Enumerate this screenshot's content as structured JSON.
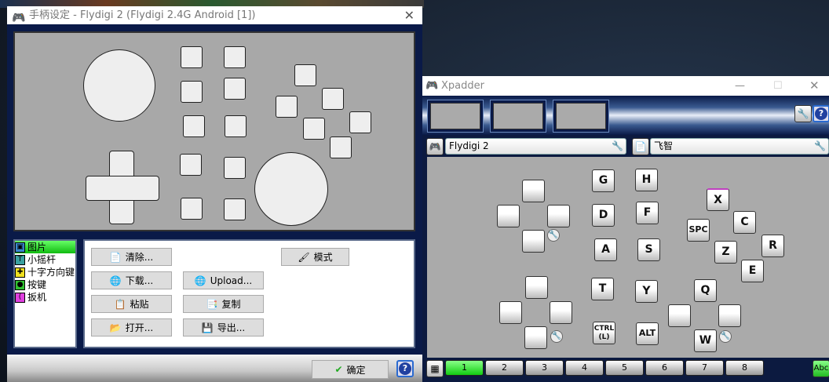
{
  "dialog": {
    "title": "手柄设定 - Flydigi 2 (Flydigi 2.4G Android [1])",
    "close": "✕",
    "list": [
      {
        "label": "图片",
        "icon": "image-icon",
        "color": "#3a8ad0"
      },
      {
        "label": "小摇杆",
        "icon": "stick-icon",
        "color": "#3aa0a0"
      },
      {
        "label": "十字方向键",
        "icon": "dpad-icon",
        "color": "#f0e020"
      },
      {
        "label": "按键",
        "icon": "button-icon",
        "color": "#30c030"
      },
      {
        "label": "扳机",
        "icon": "trigger-icon",
        "color": "#e040e0"
      }
    ],
    "buttons": {
      "clear": "清除...",
      "download": "下载...",
      "paste": "粘贴",
      "open": "打开...",
      "upload": "Upload...",
      "copy": "复制",
      "export": "导出...",
      "mode": "模式"
    },
    "ok": "确定",
    "help": "?"
  },
  "xpadder": {
    "title": "Xpadder",
    "controller": "Flydigi 2",
    "profile": "飞智",
    "help": "?",
    "keys": {
      "g": "G",
      "h": "H",
      "d": "D",
      "f": "F",
      "a": "A",
      "s": "S",
      "t": "T",
      "y": "Y",
      "ctrl": "CTRL (L)",
      "alt": "ALT",
      "x": "X",
      "c": "C",
      "spc": "SPC",
      "r": "R",
      "z": "Z",
      "e": "E",
      "q": "Q",
      "w": "W"
    },
    "sets": [
      "1",
      "2",
      "3",
      "4",
      "5",
      "6",
      "7",
      "8"
    ],
    "active_set": "1",
    "abc": "Abc"
  }
}
